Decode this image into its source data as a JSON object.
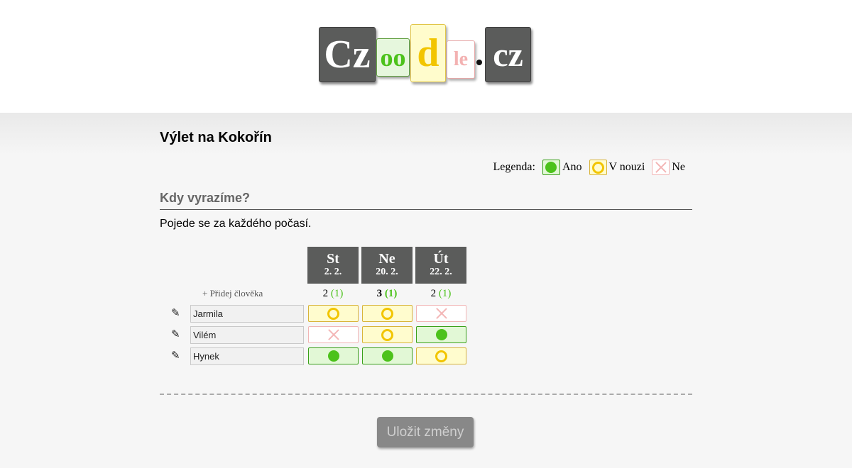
{
  "logo": {
    "part1": "Cz",
    "part2": "oo",
    "part3": "d",
    "part4": "le",
    "part5": "cz"
  },
  "poll": {
    "title": "Výlet na Kokořín",
    "question": "Kdy vyrazíme?",
    "description": "Pojede se za každého počasí."
  },
  "legend": {
    "label": "Legenda:",
    "yes": "Ano",
    "maybe": "V nouzi",
    "no": "Ne"
  },
  "colors": {
    "yes": "#4cc21b",
    "maybe": "#f2c500",
    "no": "#f3b6b6",
    "header_dark": "#5b5c5b"
  },
  "dates": [
    {
      "day": "St",
      "date": "2. 2.",
      "yes_count": "2",
      "maybe_count": "(1)",
      "best": false
    },
    {
      "day": "Ne",
      "date": "20. 2.",
      "yes_count": "3",
      "maybe_count": "(1)",
      "best": true
    },
    {
      "day": "Út",
      "date": "22. 2.",
      "yes_count": "2",
      "maybe_count": "(1)",
      "best": false
    }
  ],
  "add_person_label": "+ Přidej člověka",
  "participants": [
    {
      "name": "Jarmila",
      "answers": [
        "maybe",
        "maybe",
        "no"
      ]
    },
    {
      "name": "Vilém",
      "answers": [
        "no",
        "maybe",
        "yes"
      ]
    },
    {
      "name": "Hynek",
      "answers": [
        "yes",
        "yes",
        "maybe"
      ]
    }
  ],
  "icons": {
    "edit": "pencil-icon",
    "yes": "filled-circle-icon",
    "maybe": "ring-icon",
    "no": "cross-icon"
  },
  "save_label": "Uložit změny"
}
